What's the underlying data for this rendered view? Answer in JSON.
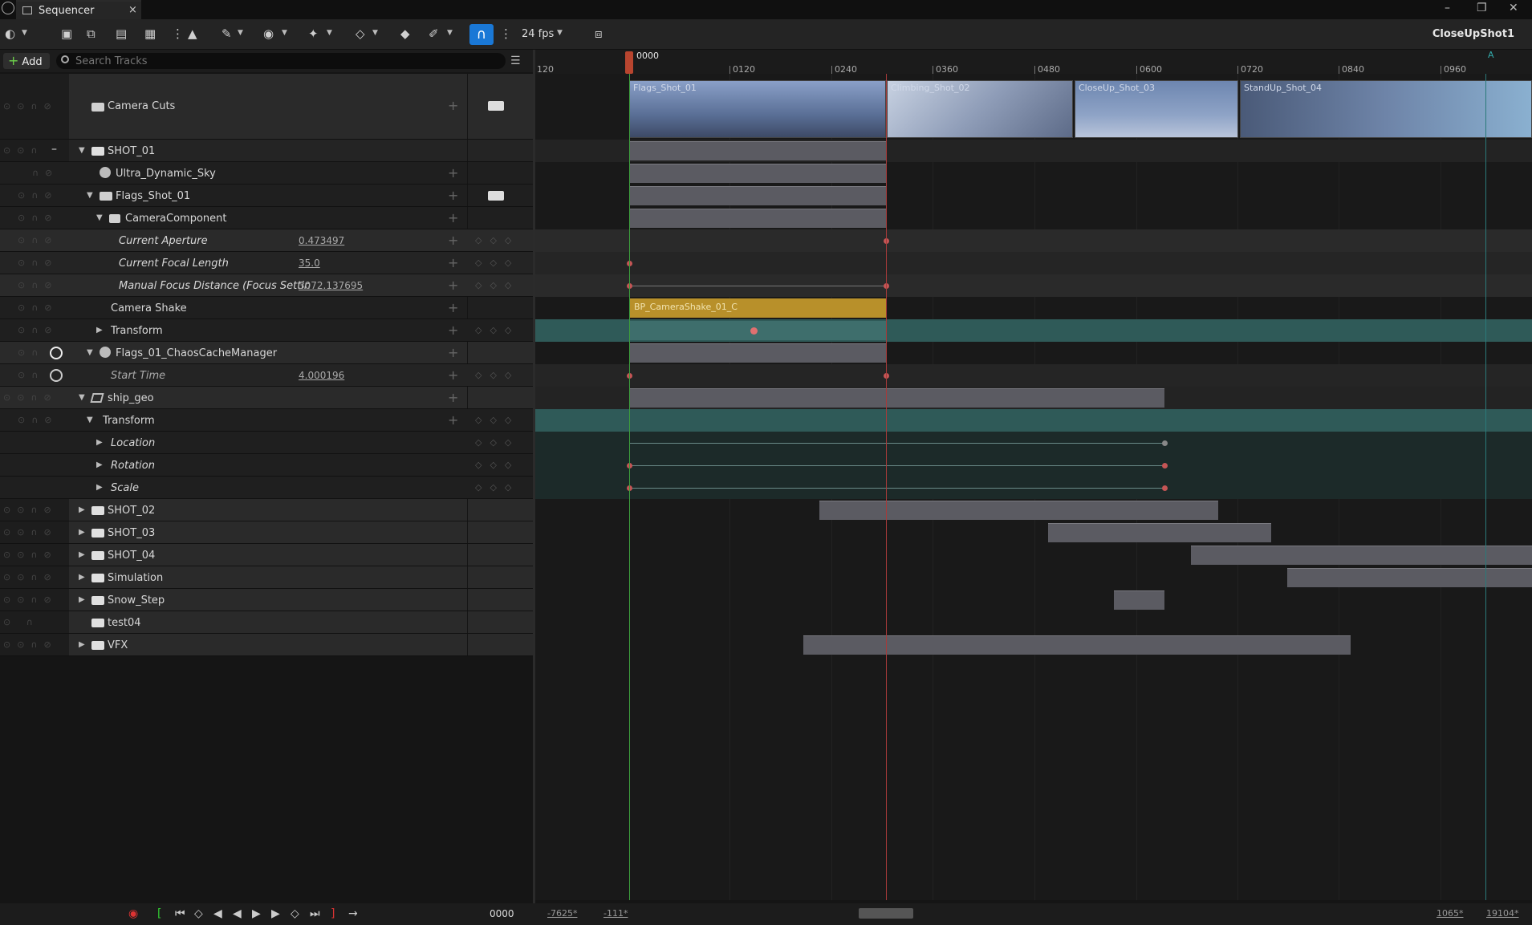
{
  "window": {
    "tab_title": "Sequencer",
    "close_glyph": "×",
    "minimize": "–",
    "restore": "❐",
    "close": "✕"
  },
  "toolbar": {
    "fps": "24 fps",
    "sequence_name": "CloseUpShot1"
  },
  "left_header": {
    "add_label": "Add",
    "search_placeholder": "Search Tracks"
  },
  "ruler": {
    "playhead_label": "0000",
    "ticks": [
      "120",
      "0120",
      "0240",
      "0360",
      "0480",
      "0600",
      "0720",
      "0840",
      "0960"
    ]
  },
  "tracks": [
    {
      "label": "Camera Cuts"
    },
    {
      "label": "SHOT_01"
    },
    {
      "label": "Ultra_Dynamic_Sky"
    },
    {
      "label": "Flags_Shot_01"
    },
    {
      "label": "CameraComponent"
    },
    {
      "label": "Current Aperture",
      "value": "0.473497"
    },
    {
      "label": "Current Focal Length",
      "value": "35.0"
    },
    {
      "label": "Manual Focus Distance (Focus Settin",
      "value": "3072.137695"
    },
    {
      "label": "Camera Shake"
    },
    {
      "label": "Transform"
    },
    {
      "label": "Flags_01_ChaosCacheManager"
    },
    {
      "label": "Start Time",
      "value": "4.000196"
    },
    {
      "label": "ship_geo"
    },
    {
      "label": "Transform"
    },
    {
      "label": "Location"
    },
    {
      "label": "Rotation"
    },
    {
      "label": "Scale"
    },
    {
      "label": "SHOT_02"
    },
    {
      "label": "SHOT_03"
    },
    {
      "label": "SHOT_04"
    },
    {
      "label": "Simulation"
    },
    {
      "label": "Snow_Step"
    },
    {
      "label": "test04"
    },
    {
      "label": "VFX"
    }
  ],
  "camera_cut_clips": [
    "Flags_Shot_01",
    "Climbing_Shot_02",
    "CloseUp_Shot_03",
    "StandUp_Shot_04"
  ],
  "camera_shake_section": "BP_CameraShake_01_C",
  "playback": {
    "current_frame": "0000"
  },
  "bottom": {
    "view_start": "-7625*",
    "range_start": "-111*",
    "range_end": "1065*",
    "view_end": "19104*"
  },
  "marker": "A",
  "colors": {
    "accent": "#1a78d6",
    "shake": "#b8902a",
    "transform_track": "#2f5a58",
    "keyframe": "#c45555",
    "section": "#5b5b62"
  }
}
